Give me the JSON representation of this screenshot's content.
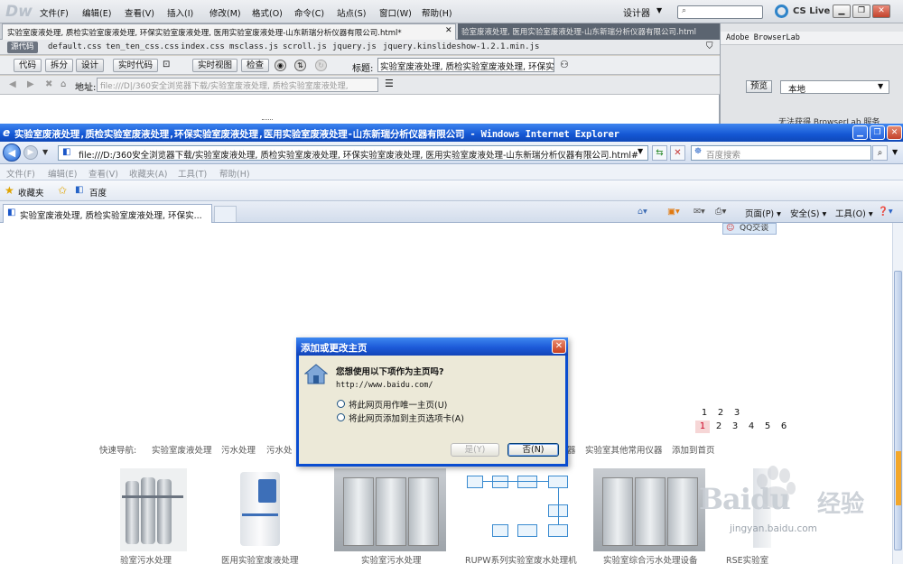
{
  "dreamweaver": {
    "logo": "Dw",
    "menus": [
      "文件(F)",
      "编辑(E)",
      "查看(V)",
      "插入(I)",
      "修改(M)",
      "格式(O)",
      "命令(C)",
      "站点(S)",
      "窗口(W)",
      "帮助(H)"
    ],
    "workspace": "设计器",
    "cslive": "CS Live",
    "tab_active": "实验室废液处理, 质检实验室废液处理, 环保实验室废液处理, 医用实验室废液处理-山东新瑞分析仪器有限公司.html*",
    "tab_inactive": "验室废液处理, 医用实验室废液处理-山东新瑞分析仪器有限公司.html",
    "related_files": {
      "source_code": "源代码",
      "files": [
        "default.css",
        "ten_ten_css.css",
        "index.css",
        "msclass.js",
        "scroll.js",
        "jquery.js",
        "jquery.kinslideshow-1.2.1.min.js"
      ]
    },
    "doc_toolbar": {
      "code": "代码",
      "split": "拆分",
      "design": "设计",
      "live_code": "实时代码",
      "live_view": "实时视图",
      "inspect": "检查",
      "title_label": "标题:",
      "title_value": "实验室废液处理, 质检实验室废液处理, 环保实验"
    },
    "address_label": "地址:",
    "address_value": "file:///D|/360安全浏览器下载/实验室废液处理, 质检实验室废液处理,",
    "browserlab": {
      "header": "Adobe BrowserLab",
      "preview": "预览",
      "local": "本地",
      "status": "无法获得 BrowserLab 服务"
    }
  },
  "ie": {
    "title": "实验室废液处理,质检实验室废液处理,环保实验室废液处理,医用实验室废液处理-山东新瑞分析仪器有限公司 - Windows Internet Explorer",
    "address": "file:///D:/360安全浏览器下载/实验室废液处理, 质检实验室废液处理, 环保实验室废液处理, 医用实验室废液处理-山东新瑞分析仪器有限公司.html#",
    "search_placeholder": "百度搜索",
    "menus": [
      "文件(F)",
      "编辑(E)",
      "查看(V)",
      "收藏夹(A)",
      "工具(T)",
      "帮助(H)"
    ],
    "favorites_label": "收藏夹",
    "favorites_link": "百度",
    "tab_title": "实验室废液处理, 质检实验室废液处理, 环保实...",
    "commands": [
      "页面(P) ▾",
      "安全(S) ▾",
      "工具(O) ▾"
    ]
  },
  "page": {
    "qq": "QQ交谈",
    "pager_top": [
      "1",
      "2",
      "3"
    ],
    "pager_bottom": [
      "1",
      "2",
      "3",
      "4",
      "5",
      "6"
    ],
    "quicknav_label": "快速导航:",
    "quicknav": [
      "实验室废液处理",
      "污水处理",
      "污水处",
      "器",
      "实验室其他常用仪器",
      "添加到首页"
    ],
    "products": [
      "验室污水处理",
      "医用实验室废液处理",
      "实验室污水处理",
      "RUPW系列实验室废水处理机",
      "实验室综合污水处理设备",
      "RSE实验室"
    ]
  },
  "dialog": {
    "title": "添加或更改主页",
    "question": "您想使用以下项作为主页吗?",
    "url": "http://www.baidu.com/",
    "option_only": "将此网页用作唯一主页(U)",
    "option_add": "将此网页添加到主页选项卡(A)",
    "yes": "是(Y)",
    "no": "否(N)"
  },
  "watermark": {
    "brand": "Baidu",
    "jingyan": "经验",
    "url": "jingyan.baidu.com"
  }
}
